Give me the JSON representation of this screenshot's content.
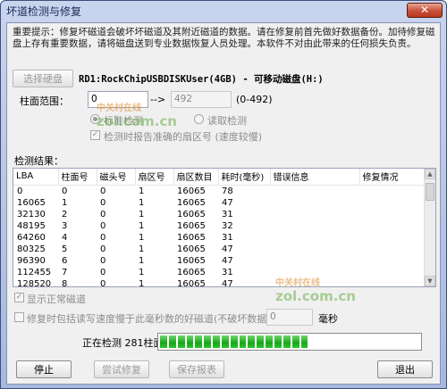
{
  "window": {
    "title": "坏道检测与修复",
    "close_glyph": "✕"
  },
  "warning_text": "重要提示：修复坏磁道会破坏坏磁道及其附近磁道的数据。请在修复前首先做好数据备份。加待修复磁盘上存有重要数据，请将磁盘送到专业数据恢复人员处理。本软件不对由此带来的任何损失负责。",
  "disk": {
    "select_label": "选择硬盘",
    "info": "RD1:RockChipUSBDISKUser(4GB) - 可移动磁盘(H:)"
  },
  "range": {
    "label": "柱面范围：",
    "start": "0",
    "arrow": "-->",
    "end": "492",
    "hint": "(0-492)"
  },
  "modes": {
    "standard_label": "标准检测",
    "read_label": "读取检测",
    "report_sector_label": "检测时报告准确的扇区号 (速度较慢)",
    "selected": "standard"
  },
  "results": {
    "label": "检测结果：",
    "columns": [
      "LBA",
      "柱面号",
      "磁头号",
      "扇区号",
      "扇区数目",
      "耗时(毫秒)",
      "错误信息",
      "修复情况"
    ],
    "rows": [
      [
        "0",
        "0",
        "0",
        "1",
        "16065",
        "78"
      ],
      [
        "16065",
        "1",
        "0",
        "1",
        "16065",
        "47"
      ],
      [
        "32130",
        "2",
        "0",
        "1",
        "16065",
        "31"
      ],
      [
        "48195",
        "3",
        "0",
        "1",
        "16065",
        "32"
      ],
      [
        "64260",
        "4",
        "0",
        "1",
        "16065",
        "31"
      ],
      [
        "80325",
        "5",
        "0",
        "1",
        "16065",
        "47"
      ],
      [
        "96390",
        "6",
        "0",
        "1",
        "16065",
        "47"
      ],
      [
        "112455",
        "7",
        "0",
        "1",
        "16065",
        "31"
      ],
      [
        "128520",
        "8",
        "0",
        "1",
        "16065",
        "47"
      ]
    ]
  },
  "options": {
    "show_normal_label": "显示正常磁道",
    "show_normal_checked": true,
    "repair_slow_label": "修复时包括读写速度慢于此毫秒数的好磁道(不破坏数据):",
    "repair_slow_value": "0",
    "repair_slow_unit": "毫秒"
  },
  "status": {
    "text": "正在检测  281柱面",
    "progress_fraction": 0.57,
    "progress_segments_total": 30
  },
  "buttons": {
    "stop": "停止",
    "try_repair": "尝试修复",
    "save_report": "保存报表",
    "exit": "退出"
  },
  "watermark": {
    "cn": "中关村在线",
    "en": "zol.com.cn"
  }
}
